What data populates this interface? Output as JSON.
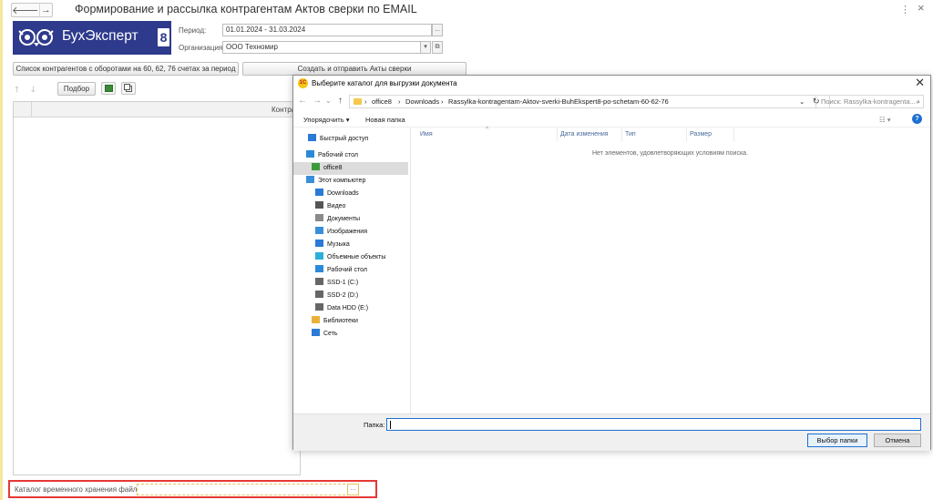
{
  "window": {
    "title": "Формирование и рассылка контрагентам Актов сверки по EMAIL",
    "back_glyph": "🡐",
    "forward_glyph": "→",
    "more_glyph": "⋮",
    "close_glyph": "×"
  },
  "logo": {
    "text": "БухЭксперт",
    "badge": "8",
    "brand_color": "#2e3a8c"
  },
  "form": {
    "period_label": "Период:",
    "period_value": "01.01.2024 - 31.03.2024",
    "period_btn": "...",
    "org_label": "Организация:",
    "org_value": "ООО Техномир",
    "org_dropdown": "▾",
    "org_open": "⧉"
  },
  "buttons": {
    "list_btn": "Список контрагентов с оборотами на 60, 62, 76 счетах за период",
    "create_btn": "Создать и отправить Акты сверки",
    "pick_btn": "Подбор"
  },
  "table": {
    "header": "Контра"
  },
  "bottom": {
    "catalog_label": "Каталог временного хранения файлов:",
    "catalog_btn": "..."
  },
  "dialog": {
    "title": "Выберите каталог для выгрузки документа",
    "icon_text": "1С",
    "close": "✕",
    "address": {
      "sep": "›",
      "parts": [
        "office8",
        "Downloads",
        "Rassylka-kontragentam-Aktov-sverki-BuhEkspert8-po-schetam-60-62-76"
      ],
      "dropdown": "⌄",
      "refresh": "↻"
    },
    "search_placeholder": "Поиск: Rassylka-kontragenta...",
    "search_icon": "⌕",
    "commands": {
      "organize": "Упорядочить ▾",
      "new_folder": "Новая папка",
      "help": "?",
      "view": "☷ ▾"
    },
    "nav": [
      {
        "label": "Быстрый доступ",
        "icon": "star-icon",
        "color": "#2a7ad6"
      },
      {
        "label": "Рабочий стол",
        "icon": "desktop-icon",
        "color": "#2a8ad8"
      },
      {
        "label": "office8",
        "icon": "user-icon",
        "color": "#3c9a3c"
      },
      {
        "label": "Этот компьютер",
        "icon": "computer-icon",
        "color": "#3a8fd8"
      },
      {
        "label": "Downloads",
        "icon": "download-icon",
        "color": "#2a7ad6"
      },
      {
        "label": "Видео",
        "icon": "video-icon",
        "color": "#555555"
      },
      {
        "label": "Документы",
        "icon": "document-icon",
        "color": "#8a8a8a"
      },
      {
        "label": "Изображения",
        "icon": "image-icon",
        "color": "#3a8fd8"
      },
      {
        "label": "Музыка",
        "icon": "music-icon",
        "color": "#2a7ad6"
      },
      {
        "label": "Объемные объекты",
        "icon": "cube-icon",
        "color": "#2ab0d8"
      },
      {
        "label": "Рабочий стол",
        "icon": "desktop-icon",
        "color": "#2a8ad8"
      },
      {
        "label": "SSD-1 (C:)",
        "icon": "drive-icon",
        "color": "#666666"
      },
      {
        "label": "SSD-2 (D:)",
        "icon": "drive-icon",
        "color": "#666666"
      },
      {
        "label": "Data HDD (E:)",
        "icon": "drive-icon",
        "color": "#666666"
      },
      {
        "label": "Библиотеки",
        "icon": "library-icon",
        "color": "#e8b23a"
      },
      {
        "label": "Сеть",
        "icon": "network-icon",
        "color": "#2a7ad6"
      }
    ],
    "columns": [
      "Имя",
      "Дата изменения",
      "Тип",
      "Размер"
    ],
    "sort_glyph": "^",
    "empty_message": "Нет элементов, удовлетворяющих условиям поиска.",
    "folder_label": "Папка:",
    "folder_value": "",
    "ok_btn": "Выбор папки",
    "cancel_btn": "Отмена",
    "accent": "#1e6fd1"
  }
}
